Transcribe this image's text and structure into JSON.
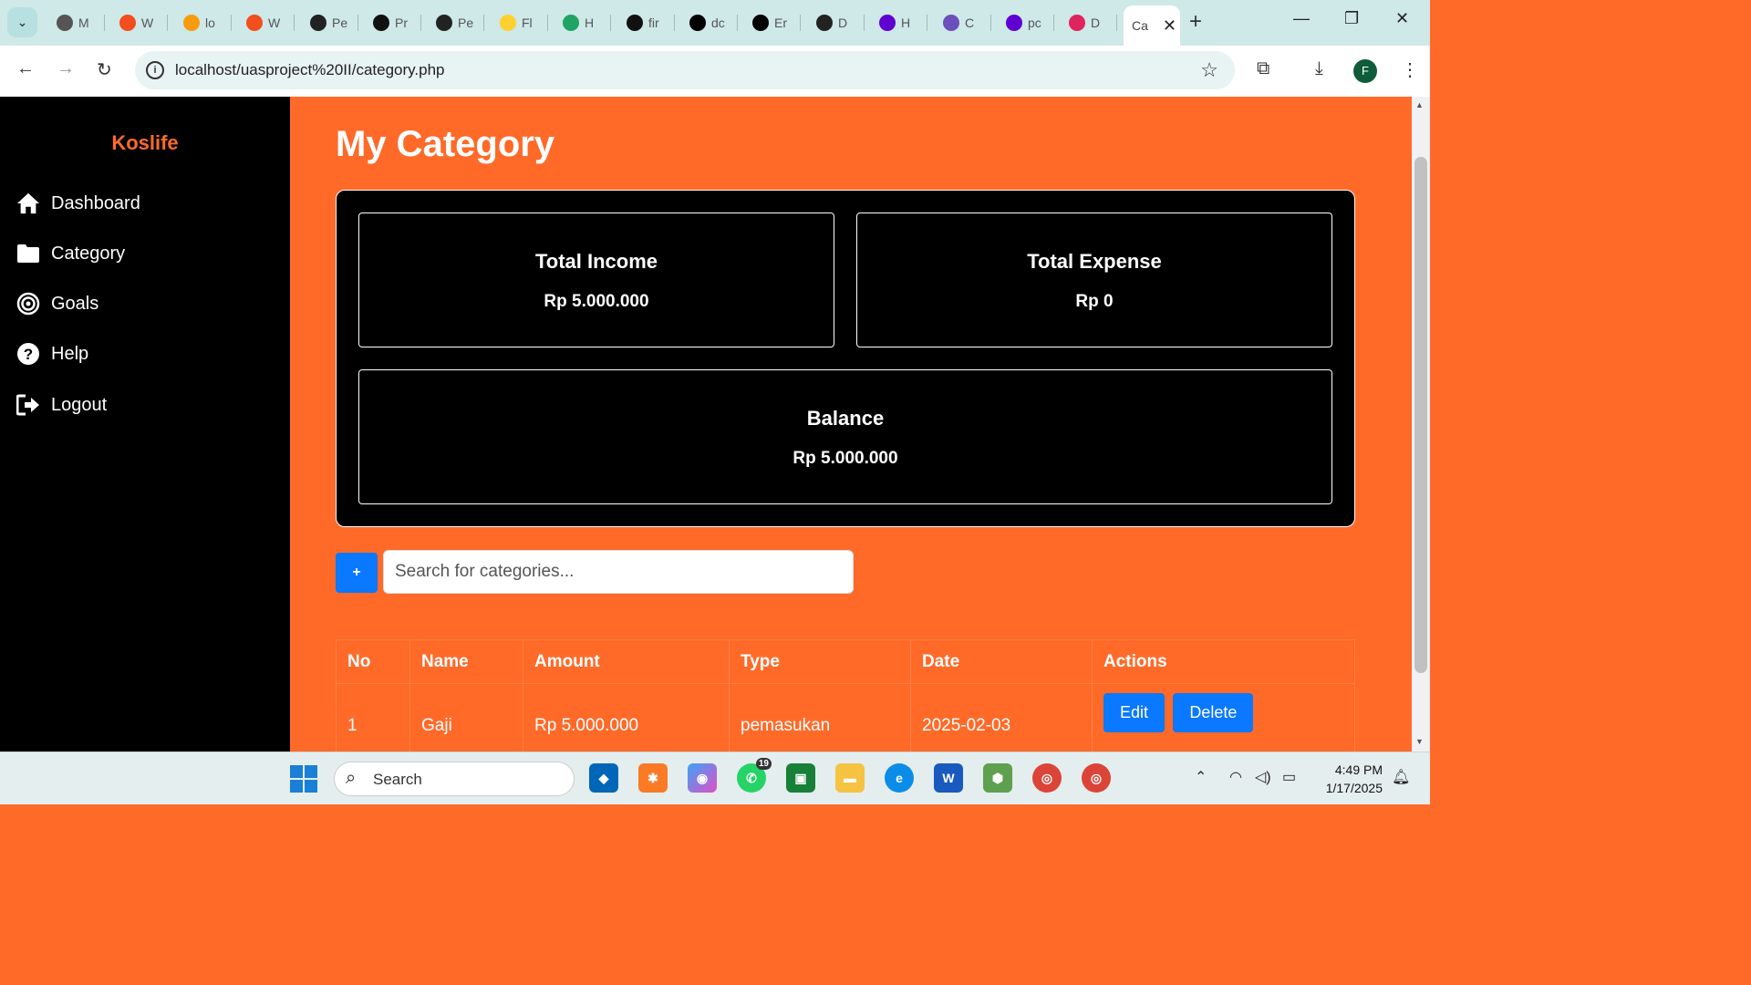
{
  "browser": {
    "tabs": [
      {
        "short": "M",
        "icon": "globe-icon",
        "color": "#555555"
      },
      {
        "short": "W",
        "icon": "figma-icon",
        "color": "#f24e1e"
      },
      {
        "short": "lo",
        "icon": "phpmyadmin-icon",
        "color": "#f89c0e"
      },
      {
        "short": "W",
        "icon": "figma-icon",
        "color": "#f24e1e"
      },
      {
        "short": "Pe",
        "icon": "openai-icon",
        "color": "#222222"
      },
      {
        "short": "Pr",
        "icon": "notion-icon",
        "color": "#111111"
      },
      {
        "short": "Pe",
        "icon": "codepen-icon",
        "color": "#222222"
      },
      {
        "short": "Fl",
        "icon": "miro-icon",
        "color": "#ffd02f"
      },
      {
        "short": "H",
        "icon": "google-drive-icon",
        "color": "#1fa463"
      },
      {
        "short": "fir",
        "icon": "github-icon",
        "color": "#111111"
      },
      {
        "short": "dc",
        "icon": "vercel-icon",
        "color": "#000000"
      },
      {
        "short": "Er",
        "icon": "vercel-icon",
        "color": "#000000"
      },
      {
        "short": "D",
        "icon": "codepen-icon",
        "color": "#222222"
      },
      {
        "short": "H",
        "icon": "yahoo-icon",
        "color": "#6001d2"
      },
      {
        "short": "C",
        "icon": "app-icon",
        "color": "#6b4fbb"
      },
      {
        "short": "pc",
        "icon": "yahoo-icon",
        "color": "#6001d2"
      },
      {
        "short": "D",
        "icon": "heart-icon",
        "color": "#e0245e"
      }
    ],
    "active_tab": "Ca",
    "url": "localhost/uasproject%20II/category.php",
    "profile_initial": "F"
  },
  "sidebar": {
    "brand": "Koslife",
    "items": [
      {
        "label": "Dashboard",
        "icon": "home-icon"
      },
      {
        "label": "Category",
        "icon": "folder-icon"
      },
      {
        "label": "Goals",
        "icon": "target-icon"
      },
      {
        "label": "Help",
        "icon": "question-icon"
      },
      {
        "label": "Logout",
        "icon": "logout-icon"
      }
    ]
  },
  "main": {
    "title": "My Category",
    "cards": {
      "income": {
        "title": "Total Income",
        "value": "Rp 5.000.000"
      },
      "expense": {
        "title": "Total Expense",
        "value": "Rp 0"
      },
      "balance": {
        "title": "Balance",
        "value": "Rp 5.000.000"
      }
    },
    "add_label": "+",
    "search_placeholder": "Search for categories...",
    "table": {
      "headers": [
        "No",
        "Name",
        "Amount",
        "Type",
        "Date",
        "Actions"
      ],
      "rows": [
        {
          "no": "1",
          "name": "Gaji",
          "amount": "Rp 5.000.000",
          "type": "pemasukan",
          "date": "2025-02-03",
          "edit": "Edit",
          "delete": "Delete"
        }
      ]
    }
  },
  "taskbar": {
    "search_label": "Search",
    "whatsapp_badge": "19",
    "time": "4:49 PM",
    "date": "1/17/2025"
  },
  "colors": {
    "accent": "#ff6a29",
    "button": "#0a78ff",
    "sidebar": "#000000"
  }
}
